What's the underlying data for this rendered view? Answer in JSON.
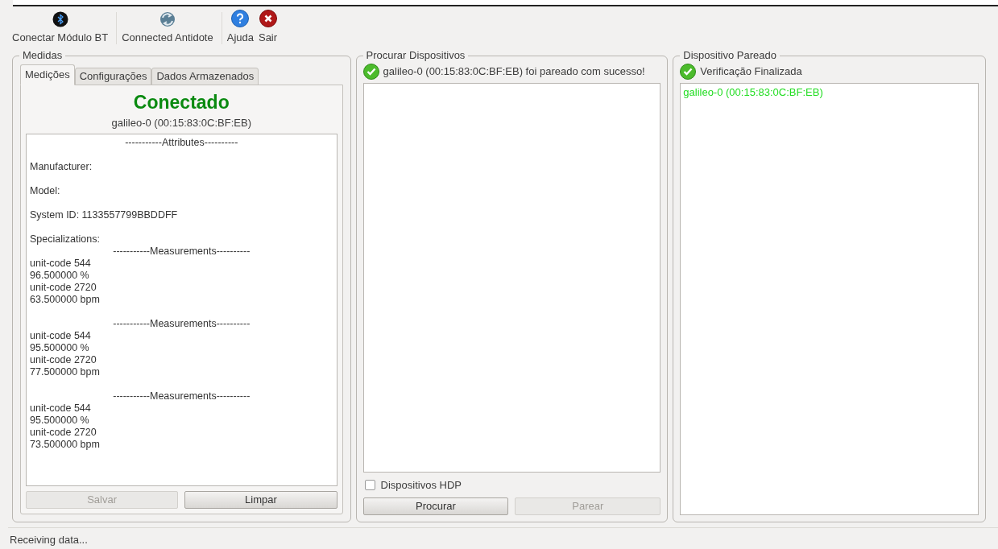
{
  "toolbar": [
    {
      "kind": "bluetooth",
      "label": "Conectar Módulo BT"
    },
    {
      "kind": "antidote",
      "label": "Connected Antidote"
    },
    {
      "kind": "help",
      "label": "Ajuda"
    },
    {
      "kind": "exit",
      "label": "Sair"
    }
  ],
  "measures": {
    "title": "Medidas",
    "tabs": [
      {
        "label": "Medições",
        "selected": true
      },
      {
        "label": "Configurações",
        "selected": false
      },
      {
        "label": "Dados Armazenados",
        "selected": false
      }
    ],
    "status": "Conectado",
    "device": "galileo-0 (00:15:83:0C:BF:EB)",
    "log": [
      {
        "kind": "heading",
        "text": "-----------Attributes----------"
      },
      {
        "kind": "gap"
      },
      {
        "kind": "line",
        "text": "Manufacturer:"
      },
      {
        "kind": "gap"
      },
      {
        "kind": "line",
        "text": "Model:"
      },
      {
        "kind": "gap"
      },
      {
        "kind": "line",
        "text": "System ID: 1133557799BBDDFF"
      },
      {
        "kind": "gap"
      },
      {
        "kind": "line",
        "text": "Specializations:"
      },
      {
        "kind": "heading",
        "text": "-----------Measurements----------"
      },
      {
        "kind": "line",
        "text": "unit-code 544"
      },
      {
        "kind": "line",
        "text": "96.500000 %"
      },
      {
        "kind": "line",
        "text": "unit-code 2720"
      },
      {
        "kind": "line",
        "text": "63.500000 bpm"
      },
      {
        "kind": "gap"
      },
      {
        "kind": "heading",
        "text": "-----------Measurements----------"
      },
      {
        "kind": "line",
        "text": "unit-code 544"
      },
      {
        "kind": "line",
        "text": "95.500000 %"
      },
      {
        "kind": "line",
        "text": "unit-code 2720"
      },
      {
        "kind": "line",
        "text": "77.500000 bpm"
      },
      {
        "kind": "gap"
      },
      {
        "kind": "heading",
        "text": "-----------Measurements----------"
      },
      {
        "kind": "line",
        "text": "unit-code 544"
      },
      {
        "kind": "line",
        "text": "95.500000 %"
      },
      {
        "kind": "line",
        "text": "unit-code 2720"
      },
      {
        "kind": "line",
        "text": "73.500000 bpm"
      }
    ],
    "buttons": [
      {
        "label": "Salvar",
        "disabled": true
      },
      {
        "label": "Limpar",
        "disabled": false
      }
    ]
  },
  "search": {
    "title": "Procurar Dispositivos",
    "message": "galileo-0 (00:15:83:0C:BF:EB) foi pareado com sucesso!",
    "hdp_checkbox": {
      "label": "Dispositivos HDP",
      "checked": false
    },
    "buttons": [
      {
        "label": "Procurar",
        "disabled": false
      },
      {
        "label": "Parear",
        "disabled": true
      }
    ]
  },
  "paired": {
    "title": "Dispositivo Pareado",
    "message": "Verificação Finalizada",
    "devices": [
      "galileo-0 (00:15:83:0C:BF:EB)"
    ]
  },
  "status_bar": "Receiving data..."
}
